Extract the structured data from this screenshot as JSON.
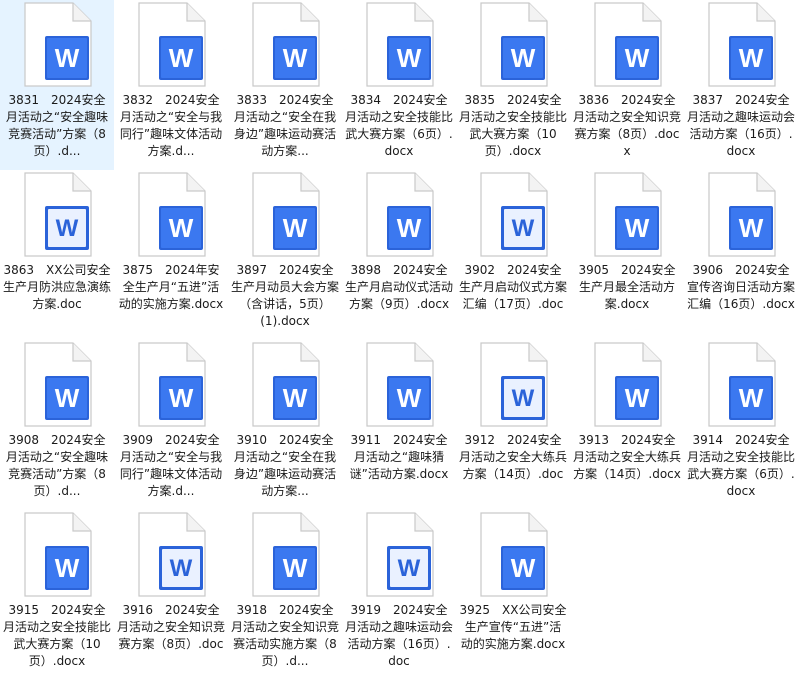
{
  "colors": {
    "page_fill": "#ffffff",
    "page_stroke": "#c9c9c9",
    "docx_badge": "#2b63d9",
    "docx_badge_inner": "#3b78f0",
    "doc_badge_border": "#2b63d9",
    "doc_badge_fill": "#eaf1ff",
    "doc_badge_letter": "#2b63d9"
  },
  "files": [
    {
      "name": "3831　2024安全月活动之“安全趣味竞赛活动”方案（8页）.d...",
      "type": "docx"
    },
    {
      "name": "3832　2024安全月活动之“安全与我同行”趣味文体活动方案.d...",
      "type": "docx"
    },
    {
      "name": "3833　2024安全月活动之“安全在我身边”趣味运动赛活动方案...",
      "type": "docx"
    },
    {
      "name": "3834　2024安全月活动之安全技能比武大赛方案（6页）.docx",
      "type": "docx"
    },
    {
      "name": "3835　2024安全月活动之安全技能比武大赛方案（10页）.docx",
      "type": "docx"
    },
    {
      "name": "3836　2024安全月活动之安全知识竞赛方案（8页）.docx",
      "type": "docx"
    },
    {
      "name": "3837　2024安全月活动之趣味运动会活动方案（16页）.docx",
      "type": "docx"
    },
    {
      "name": "3863　XX公司安全生产月防洪应急演练方案.doc",
      "type": "doc"
    },
    {
      "name": "3875　2024年安全生产月“五进”活动的实施方案.docx",
      "type": "docx"
    },
    {
      "name": "3897　2024安全生产月动员大会方案（含讲话，5页）(1).docx",
      "type": "docx"
    },
    {
      "name": "3898　2024安全生产月启动仪式活动方案（9页）.docx",
      "type": "docx"
    },
    {
      "name": "3902　2024安全生产月启动仪式方案汇编（17页）.doc",
      "type": "doc"
    },
    {
      "name": "3905　2024安全生产月最全活动方案.docx",
      "type": "docx"
    },
    {
      "name": "3906　2024安全宣传咨询日活动方案汇编（16页）.docx",
      "type": "docx"
    },
    {
      "name": "3908　2024安全月活动之“安全趣味竞赛活动”方案（8页）.d...",
      "type": "docx"
    },
    {
      "name": "3909　2024安全月活动之“安全与我同行”趣味文体活动方案.d...",
      "type": "docx"
    },
    {
      "name": "3910　2024安全月活动之“安全在我身边”趣味运动赛活动方案...",
      "type": "docx"
    },
    {
      "name": "3911　2024安全月活动之“趣味猜谜”活动方案.docx",
      "type": "docx"
    },
    {
      "name": "3912　2024安全月活动之安全大练兵方案（14页）.doc",
      "type": "doc"
    },
    {
      "name": "3913　2024安全月活动之安全大练兵方案（14页）.docx",
      "type": "docx"
    },
    {
      "name": "3914　2024安全月活动之安全技能比武大赛方案（6页）.docx",
      "type": "docx"
    },
    {
      "name": "3915　2024安全月活动之安全技能比武大赛方案（10页）.docx",
      "type": "docx"
    },
    {
      "name": "3916　2024安全月活动之安全知识竞赛方案（8页）.doc",
      "type": "doc"
    },
    {
      "name": "3918　2024安全月活动之安全知识竞赛活动实施方案（8页）.d...",
      "type": "docx"
    },
    {
      "name": "3919　2024安全月活动之趣味运动会活动方案（16页）.doc",
      "type": "doc"
    },
    {
      "name": "3925　XX公司安全生产宣传“五进”活动的实施方案.docx",
      "type": "docx"
    }
  ]
}
